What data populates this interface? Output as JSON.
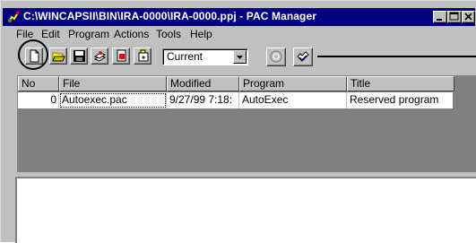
{
  "window": {
    "title": "C:\\WINCAPSII\\BIN\\IRA-0000\\IRA-0000.ppj - PAC Manager"
  },
  "menu": [
    {
      "label": "File"
    },
    {
      "label": "Edit"
    },
    {
      "label": "Program"
    },
    {
      "label": "Actions"
    },
    {
      "label": "Tools"
    },
    {
      "label": "Help"
    }
  ],
  "toolbar": {
    "buttons": [
      {
        "icon": "new-file-icon"
      },
      {
        "icon": "open-folder-icon"
      },
      {
        "icon": "save-icon"
      },
      {
        "icon": "compile-icon"
      },
      {
        "icon": "delete-icon"
      },
      {
        "icon": "transfer-icon"
      }
    ],
    "mode_select": {
      "value": "Current"
    },
    "disabled_icon": "stop-icon",
    "check_icon": "check-icon"
  },
  "table": {
    "columns": [
      "No",
      "File",
      "Modified",
      "Program",
      "Title"
    ],
    "rows": [
      {
        "no": "0",
        "file": "Autoexec.pac",
        "modified": "9/27/99 7:18:",
        "program": "AutoExec",
        "title": "Reserved program"
      }
    ]
  },
  "colors": {
    "titlebar": "#000080",
    "face": "#c0c0c0",
    "listbg": "#808080"
  }
}
